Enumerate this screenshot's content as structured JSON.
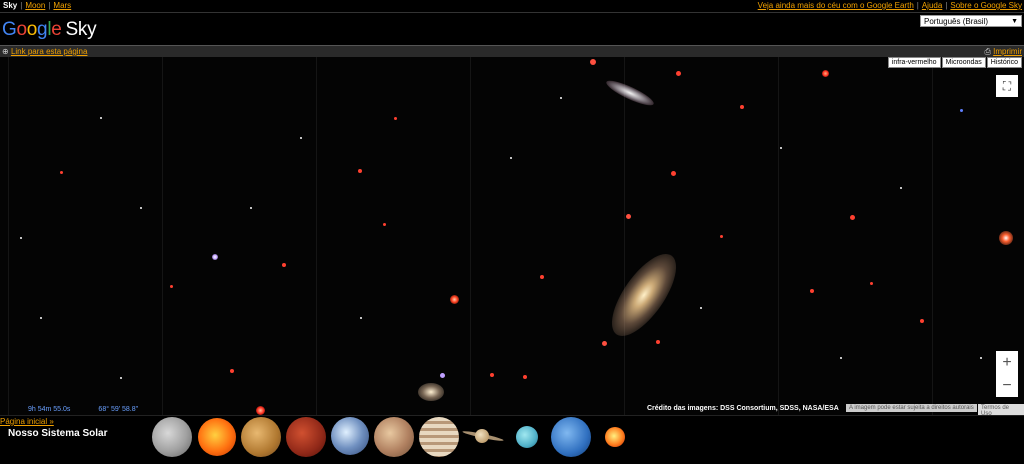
{
  "topnav": {
    "sky": "Sky",
    "moon": "Moon",
    "mars": "Mars",
    "earth_link": "Veja ainda mais do céu com o Google Earth",
    "help": "Ajuda",
    "about": "Sobre o Google Sky"
  },
  "logo": {
    "google": "Google",
    "sky": "Sky"
  },
  "language": {
    "selected": "Português (Brasil)"
  },
  "linkbar": {
    "link": "Link para esta página",
    "print": "Imprimir"
  },
  "layers": {
    "infrared": "infra-vermelho",
    "microwave": "Microondas",
    "historical": "Histórico"
  },
  "coords": {
    "ra": "9h 54m 55.0s",
    "dec": "68° 59' 58.8\""
  },
  "credits": {
    "imagery": "Crédito das imagens: DSS Consortium, SDSS, NASA/ESA",
    "rights": "A imagem pode estar sujeita a direitos autorais",
    "terms": "Termos de Uso"
  },
  "bottom": {
    "home": "Página inicial »",
    "solar_title": "Nosso Sistema Solar"
  },
  "zoom": {
    "plus": "+",
    "minus": "−"
  },
  "icons": {
    "fullscreen": "fullscreen-icon",
    "print": "printer-icon"
  },
  "colors": {
    "link": "#f0a000",
    "google_blue": "#4285f4",
    "google_red": "#ea4335",
    "google_yellow": "#fbbc05",
    "google_green": "#34a853"
  }
}
